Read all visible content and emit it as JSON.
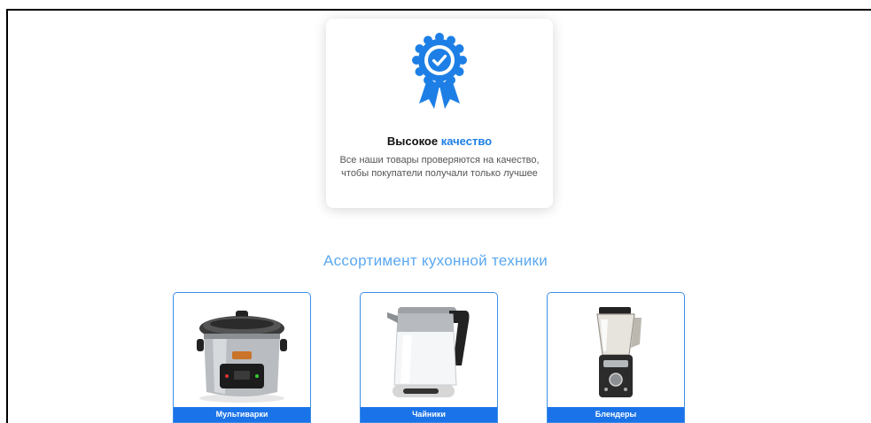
{
  "features": {
    "quality": {
      "icon": "award-ribbon-icon",
      "title_main": "Высокое",
      "title_accent": "качество",
      "line1": "Все наши товары проверяются на качество,",
      "line2": "чтобы покупатели получали только лучшее"
    }
  },
  "assortment": {
    "title": "Ассортимент кухонной техники",
    "categories": [
      {
        "label": "Мультиварки",
        "icon": "multicooker-image"
      },
      {
        "label": "Чайники",
        "icon": "kettle-image"
      },
      {
        "label": "Блендеры",
        "icon": "blender-image"
      }
    ]
  },
  "colors": {
    "accent": "#1d7fe6",
    "section_title": "#5aa8f0",
    "label_bg": "#1a73e8",
    "card_border": "#3b8fe8"
  }
}
